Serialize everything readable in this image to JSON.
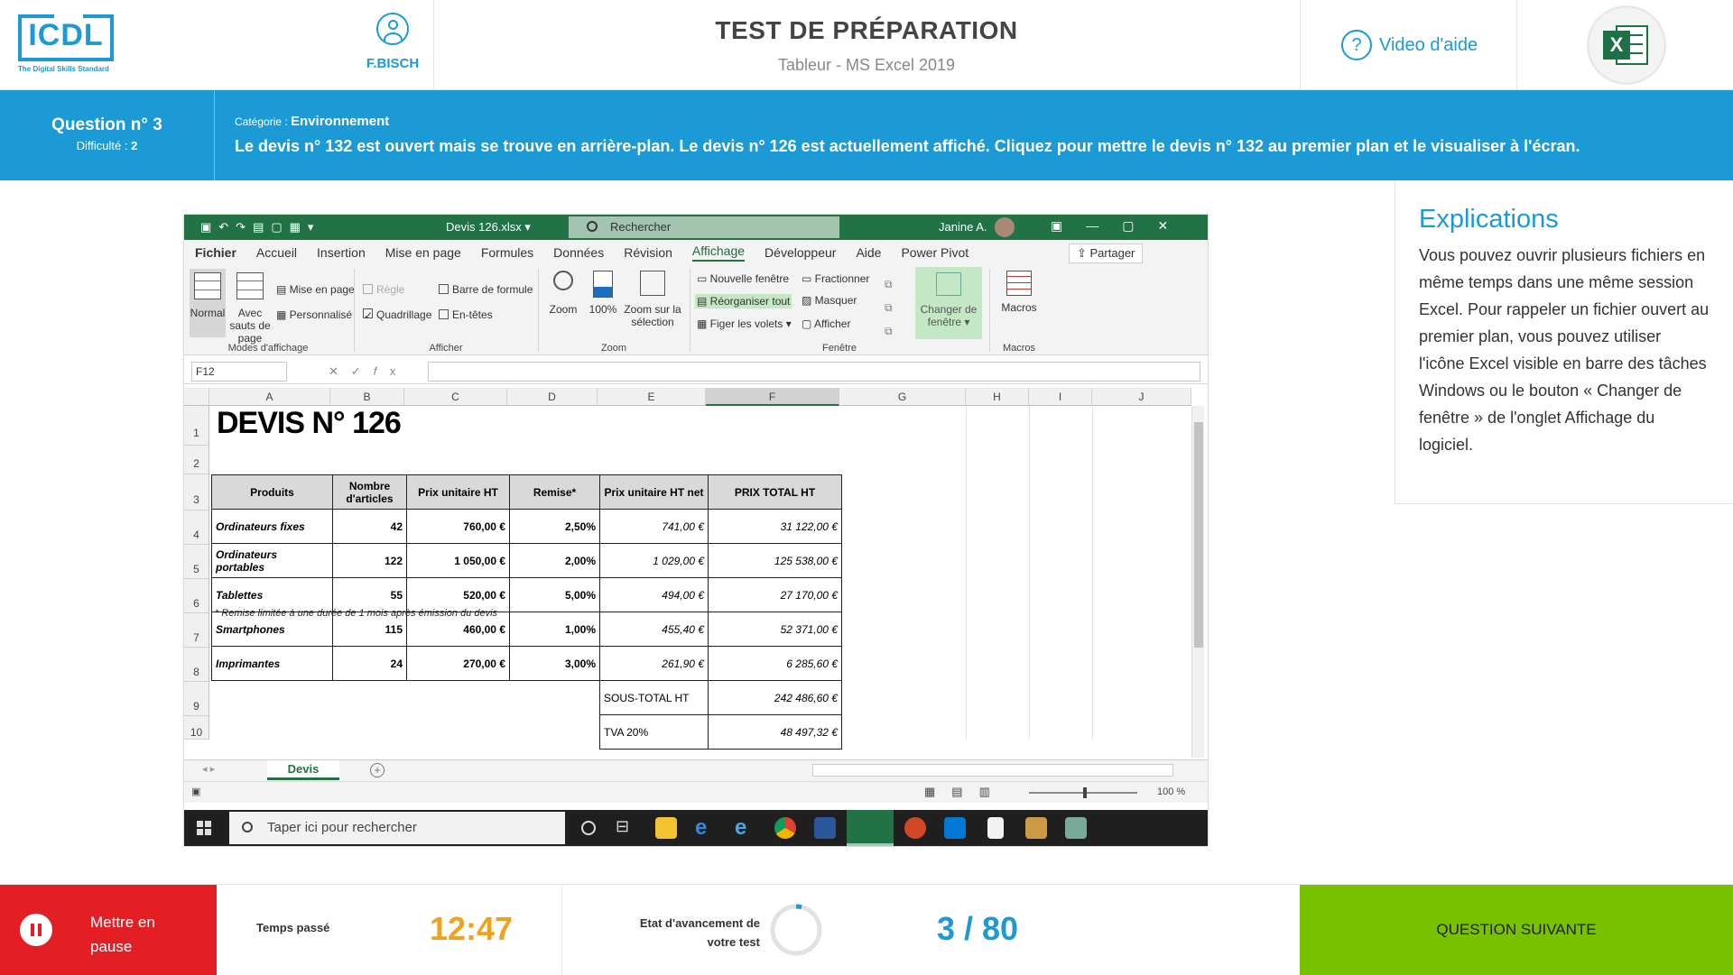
{
  "header": {
    "logo_text": "ICDL",
    "logo_tagline": "The Digital Skills Standard",
    "user_name": "F.BISCH",
    "title": "TEST DE PRÉPARATION",
    "subtitle": "Tableur - MS Excel 2019",
    "help_label": "Video d'aide",
    "app_icon": "excel-icon"
  },
  "question": {
    "number_label": "Question n° 3",
    "difficulty_label": "Difficulté :",
    "difficulty_value": "2",
    "category_label": "Catégorie :",
    "category_value": "Environnement",
    "text": "Le devis n° 132 est ouvert mais se trouve en arrière-plan. Le devis n° 126 est actuellement affiché. Cliquez pour mettre le devis n° 132 au premier plan et le visualiser à l'écran."
  },
  "excel": {
    "filename": "Devis 126.xlsx ▾",
    "search_placeholder": "Rechercher",
    "account_name": "Janine A.",
    "tabs": [
      "Fichier",
      "Accueil",
      "Insertion",
      "Mise en page",
      "Formules",
      "Données",
      "Révision",
      "Affichage",
      "Développeur",
      "Aide",
      "Power Pivot"
    ],
    "active_tab": "Affichage",
    "share_label": "Partager",
    "ribbon": {
      "normal": "Normal",
      "avec_sauts": "Avec sauts de page",
      "mise_en_page": "Mise en page",
      "personnalise": "Personnalisé",
      "group_modes": "Modes d'affichage",
      "regle": "Règle",
      "quadrillage": "Quadrillage",
      "barre_formule": "Barre de formule",
      "en_tetes": "En-têtes",
      "group_afficher": "Afficher",
      "zoom": "Zoom",
      "zoom100": "100%",
      "zoom_sel": "Zoom sur la sélection",
      "group_zoom": "Zoom",
      "nouvelle_fenetre": "Nouvelle fenêtre",
      "reorganiser": "Réorganiser tout",
      "figer": "Figer les volets ▾",
      "fractionner": "Fractionner",
      "masquer": "Masquer",
      "afficher": "Afficher",
      "changer_fenetre": "Changer de fenêtre ▾",
      "group_fenetre": "Fenêtre",
      "macros": "Macros",
      "group_macros": "Macros"
    },
    "name_box": "F12",
    "columns": [
      "A",
      "B",
      "C",
      "D",
      "E",
      "F",
      "G",
      "H",
      "I",
      "J"
    ],
    "rows": [
      "1",
      "2",
      "3",
      "4",
      "5",
      "6",
      "7",
      "8",
      "9",
      "10"
    ],
    "sheet_title": "DEVIS N° 126",
    "table_headers": [
      "Produits",
      "Nombre d'articles",
      "Prix unitaire HT",
      "Remise*",
      "Prix unitaire HT net",
      "PRIX TOTAL HT"
    ],
    "table_rows": [
      [
        "Ordinateurs fixes",
        "42",
        "760,00 €",
        "2,50%",
        "741,00 €",
        "31 122,00 €"
      ],
      [
        "Ordinateurs portables",
        "122",
        "1 050,00 €",
        "2,00%",
        "1 029,00 €",
        "125 538,00 €"
      ],
      [
        "Tablettes",
        "55",
        "520,00 €",
        "5,00%",
        "494,00 €",
        "27 170,00 €"
      ],
      [
        "Smartphones",
        "115",
        "460,00 €",
        "1,00%",
        "455,40 €",
        "52 371,00 €"
      ],
      [
        "Imprimantes",
        "24",
        "270,00 €",
        "3,00%",
        "261,90 €",
        "6 285,60 €"
      ]
    ],
    "note": "* Remise limitée à une durée de 1 mois après émission du devis",
    "subtotal_label": "SOUS-TOTAL HT",
    "subtotal_value": "242 486,60 €",
    "tva_label": "TVA 20%",
    "tva_value": "48 497,32 €",
    "sheet_tab": "Devis",
    "zoom_level": "100 %",
    "taskbar_search": "Taper ici pour rechercher"
  },
  "explanations": {
    "title": "Explications",
    "text": "Vous pouvez ouvrir plusieurs fichiers en même temps dans une même session Excel. Pour rappeler un fichier ouvert au premier plan, vous pouvez utiliser l'icône Excel visible en barre des tâches Windows ou le bouton « Changer de fenêtre » de l'onglet Affichage du logiciel."
  },
  "footer": {
    "pause_label": "Mettre en pause",
    "time_label": "Temps passé",
    "time_value": "12:47",
    "progress_label": "Etat d'avancement de votre test",
    "progress_value": "3 / 80",
    "progress_fraction": 0.0375,
    "next_label": "QUESTION SUIVANTE"
  },
  "colors": {
    "brand_blue": "#1b9ad6",
    "excel_green": "#217346",
    "pause_red": "#e31e24",
    "next_green": "#77c100",
    "timer_orange": "#f0a21e"
  }
}
